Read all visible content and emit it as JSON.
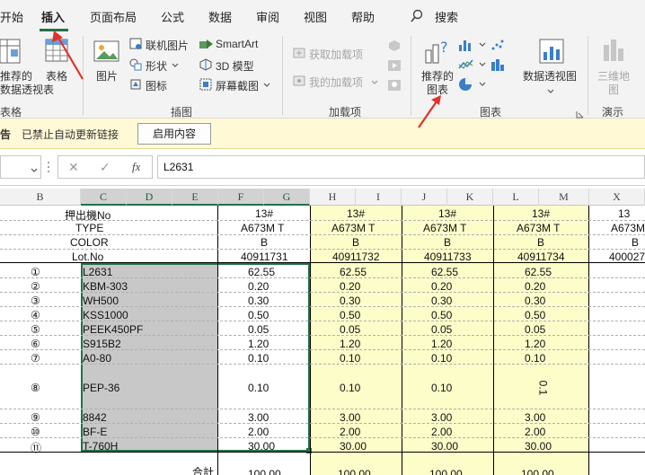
{
  "tabs": [
    {
      "label": "开始",
      "active": false
    },
    {
      "label": "插入",
      "active": true
    },
    {
      "label": "页面布局",
      "active": false
    },
    {
      "label": "公式",
      "active": false
    },
    {
      "label": "数据",
      "active": false
    },
    {
      "label": "审阅",
      "active": false
    },
    {
      "label": "视图",
      "active": false
    },
    {
      "label": "帮助",
      "active": false
    }
  ],
  "search_label": "搜索",
  "ribbon": {
    "pivot_partial": "推荐的\n数据透视表",
    "pivot_line1": "推荐的",
    "pivot_line2": "数据透视表",
    "table": "表格",
    "pictures": "图片",
    "online_pictures": "联机图片",
    "shapes": "形状",
    "icons": "图标",
    "smartart": "SmartArt",
    "model3d": "3D 模型",
    "screenshot": "屏幕截图",
    "get_addins": "获取加载项",
    "my_addins": "我的加载项",
    "rec_charts_line1": "推荐的",
    "rec_charts_line2": "图表",
    "pivot_chart": "数据透视图",
    "map3d_line1": "三维地",
    "map3d_line2": "图",
    "groups": {
      "tables": "表格",
      "illustrations": "插图",
      "addins": "加载项",
      "charts": "图表",
      "tours": "演示"
    }
  },
  "message_bar": {
    "label": "告",
    "text": "已禁止自动更新链接",
    "button": "启用内容"
  },
  "formula_bar": {
    "cancel": "✕",
    "confirm": "✓",
    "fx": "fx",
    "value": "L2631"
  },
  "columns": [
    "B",
    "C",
    "D",
    "E",
    "F",
    "G",
    "H",
    "I",
    "J",
    "K",
    "L",
    "M",
    "X"
  ],
  "header_rows": [
    {
      "label": "押出機No",
      "values": [
        "13#",
        "13#",
        "13#",
        "13#",
        "13#",
        "13"
      ]
    },
    {
      "label": "TYPE",
      "values": [
        "A673M T",
        "A673M T",
        "A673M T",
        "A673M T",
        "A673M T",
        "A673M"
      ]
    },
    {
      "label": "COLOR",
      "values": [
        "B",
        "B",
        "B",
        "B",
        "B",
        "B"
      ]
    },
    {
      "label": "Lot.No",
      "values": [
        "40911731",
        "40911732",
        "40911733",
        "40911734",
        "40911734",
        "400027"
      ]
    }
  ],
  "data_rows": [
    {
      "num": "①",
      "name": "L2631",
      "values": [
        "62.55",
        "62.55",
        "62.55",
        "62.55"
      ]
    },
    {
      "num": "②",
      "name": "KBM-303",
      "values": [
        "0.20",
        "0.20",
        "0.20",
        "0.20"
      ]
    },
    {
      "num": "③",
      "name": "WH500",
      "values": [
        "0.30",
        "0.30",
        "0.30",
        "0.30"
      ]
    },
    {
      "num": "④",
      "name": "KSS1000",
      "values": [
        "0.50",
        "0.50",
        "0.50",
        "0.50"
      ]
    },
    {
      "num": "⑤",
      "name": "PEEK450PF",
      "values": [
        "0.05",
        "0.05",
        "0.05",
        "0.05"
      ]
    },
    {
      "num": "⑥",
      "name": "S915B2",
      "values": [
        "1.20",
        "1.20",
        "1.20",
        "1.20"
      ]
    },
    {
      "num": "⑦",
      "name": "A0-80",
      "values": [
        "0.10",
        "0.10",
        "0.10",
        "0.10"
      ]
    },
    {
      "num": "⑧",
      "name": "PEP-36",
      "values": [
        "0.10",
        "0.10",
        "0.10",
        "0.1"
      ]
    },
    {
      "num": "⑨",
      "name": "8842",
      "values": [
        "3.00",
        "3.00",
        "3.00",
        "3.00"
      ]
    },
    {
      "num": "⑩",
      "name": "BF-E",
      "values": [
        "2.00",
        "2.00",
        "2.00",
        "2.00"
      ]
    },
    {
      "num": "⑪",
      "name": "T-760H",
      "values": [
        "30.00",
        "30.00",
        "30.00",
        "30.00"
      ]
    }
  ],
  "total_row": {
    "label": "合計",
    "values": [
      "100.00",
      "100.00",
      "100.00",
      "100.00"
    ]
  },
  "colors": {
    "accent": "#217346",
    "arrow": "#e0322b",
    "selection": "#c8c8c8",
    "yellow": "#fdfdc9",
    "message_bar": "#fff9d6"
  }
}
